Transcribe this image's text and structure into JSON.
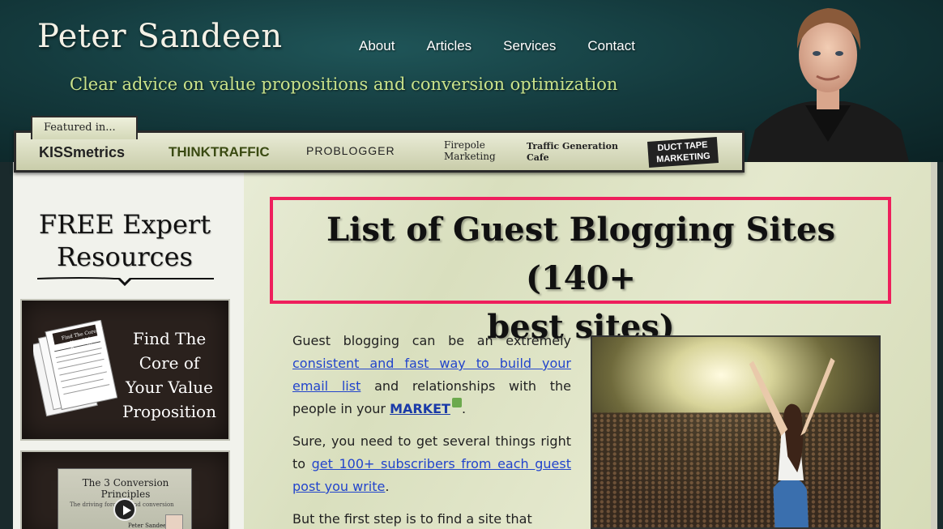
{
  "header": {
    "site_title": "Peter Sandeen",
    "tagline": "Clear advice on value propositions and conversion optimization",
    "nav": [
      {
        "label": "About"
      },
      {
        "label": "Articles"
      },
      {
        "label": "Services"
      },
      {
        "label": "Contact"
      }
    ]
  },
  "featured": {
    "label": "Featured in...",
    "logos": [
      "KISSmetrics",
      "THINKTRAFFIC",
      "PROBLOGGER",
      "Firepole Marketing",
      "Traffic Generation Cafe",
      "DUCT TAPE MARKETING"
    ]
  },
  "sidebar": {
    "title_line1": "FREE Expert",
    "title_line2": "Resources",
    "resource1": {
      "title_line1": "Find The",
      "title_line2": "Core of",
      "title_line3": "Your Value",
      "title_line4": "Proposition",
      "doc_title_line1": "Find The Core of",
      "doc_title_line2": "Your Value Proposition"
    },
    "resource2": {
      "video_title_line1": "The 3 Conversion",
      "video_title_line2": "Principles",
      "video_subtitle": "The driving force behind conversion",
      "video_author": "Peter Sandeen"
    }
  },
  "article": {
    "title_line1": "List of Guest Blogging Sites (140+",
    "title_line2": "best sites)",
    "p1_pre": "Guest blogging can be an extremely",
    "p1_link": "consistent and fast way to build your email list",
    "p1_mid": "and relationships with the people in your",
    "p1_market": "MARKET",
    "p1_end": ".",
    "p2_pre": "Sure, you need to get several things right to",
    "p2_link": "get 100+ subscribers from each guest post you write",
    "p2_end": ".",
    "p3": "But the first step is to find a site that"
  },
  "colors": {
    "highlight_border": "#ee1f5c",
    "link": "#2244cc",
    "tagline": "#c9e28a"
  }
}
